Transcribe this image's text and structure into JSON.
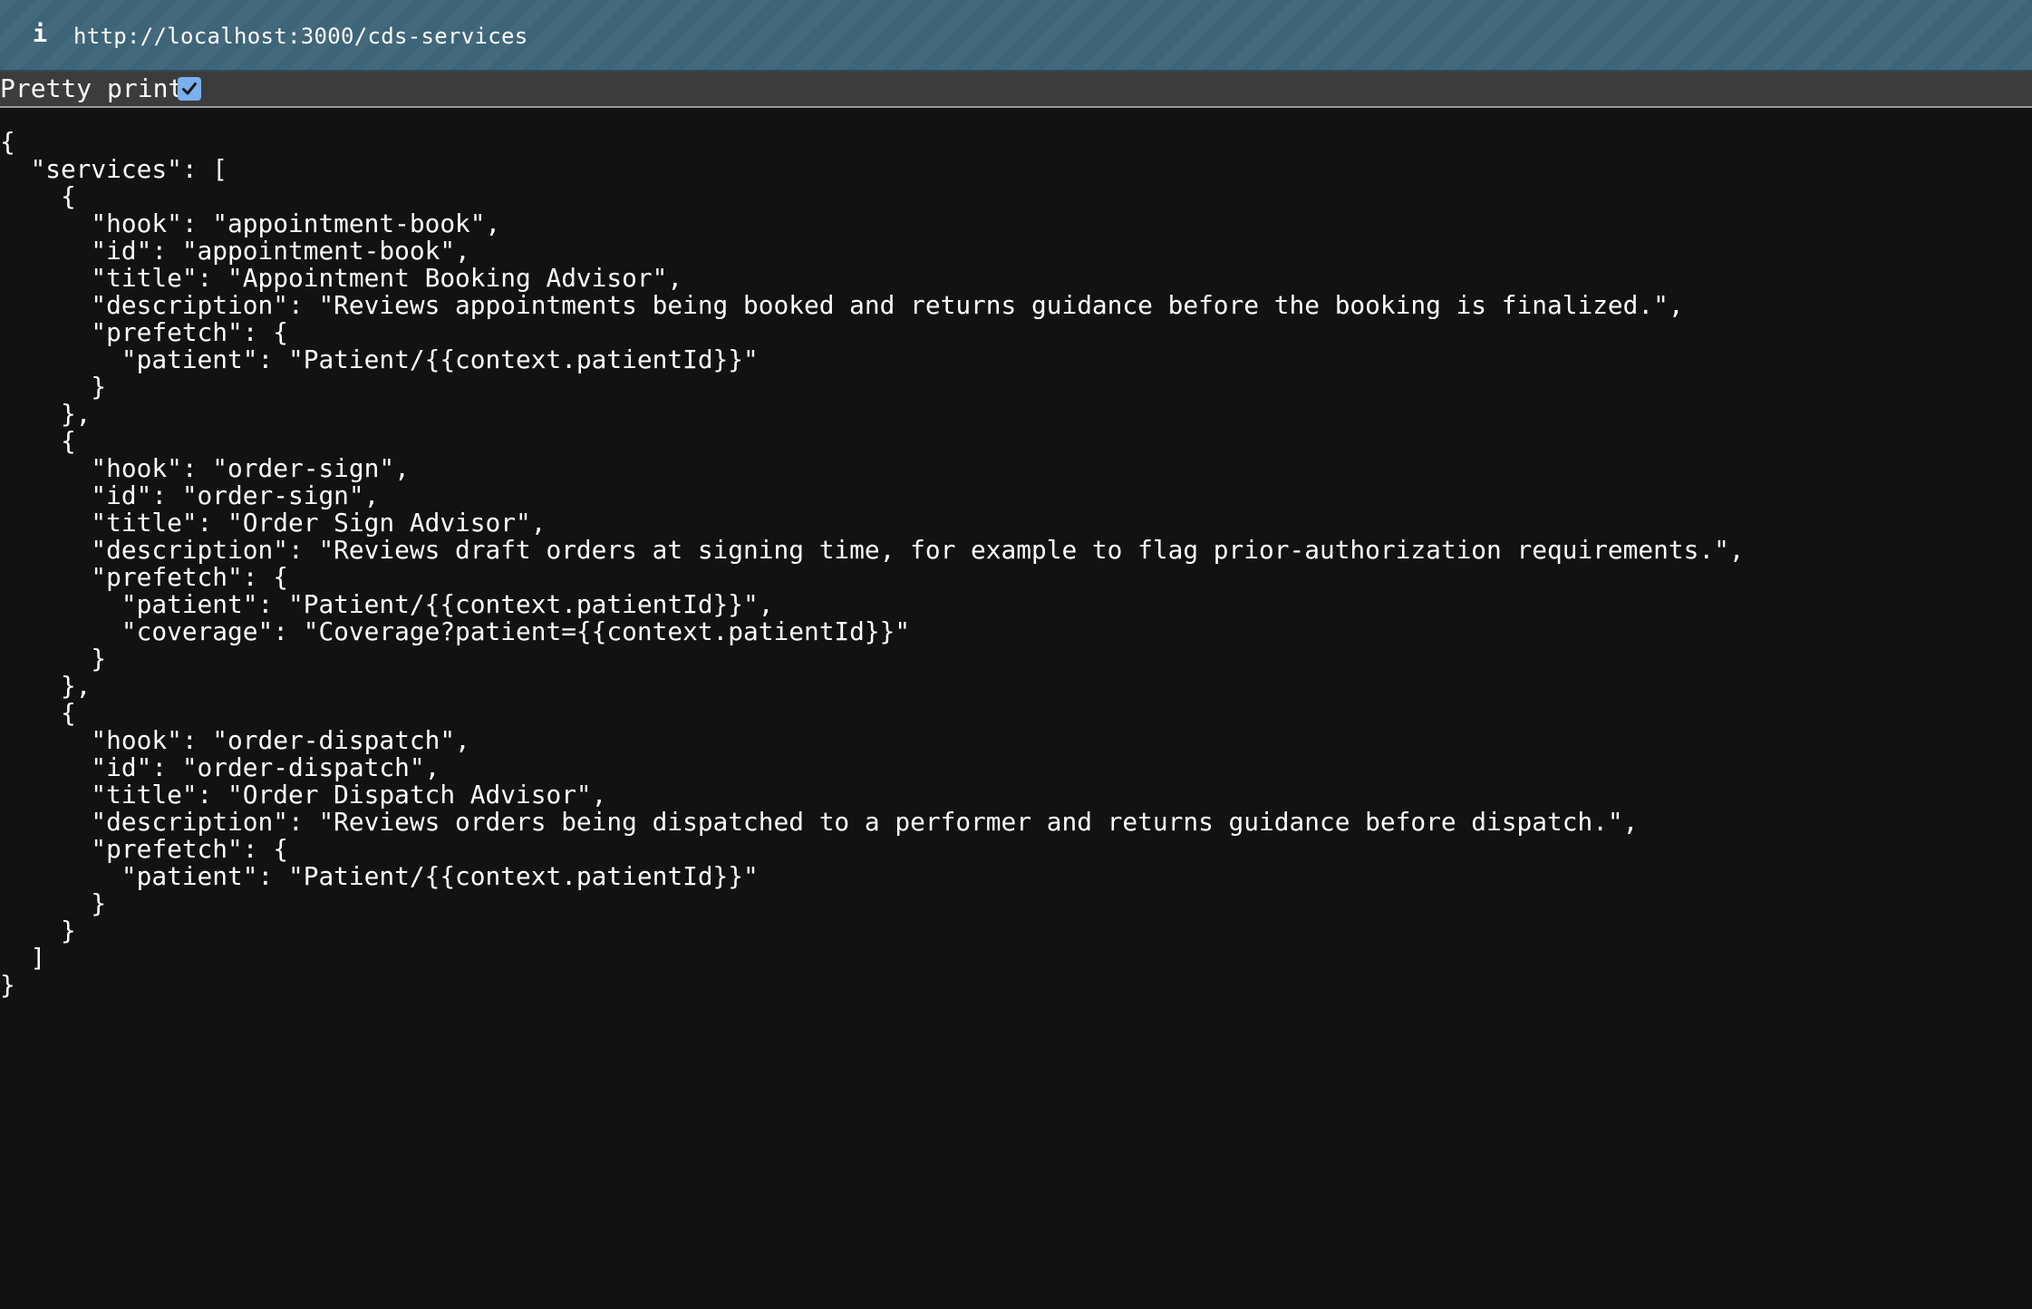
{
  "address_bar": {
    "icon": "info-icon",
    "icon_glyph": "i",
    "url": "http://localhost:3000/cds-services"
  },
  "toolbar": {
    "pretty_print_label": "Pretty print",
    "pretty_print_checked": true
  },
  "json_text": "{\n  \"services\": [\n    {\n      \"hook\": \"appointment-book\",\n      \"id\": \"appointment-book\",\n      \"title\": \"Appointment Booking Advisor\",\n      \"description\": \"Reviews appointments being booked and returns guidance before the booking is finalized.\",\n      \"prefetch\": {\n        \"patient\": \"Patient/{{context.patientId}}\"\n      }\n    },\n    {\n      \"hook\": \"order-sign\",\n      \"id\": \"order-sign\",\n      \"title\": \"Order Sign Advisor\",\n      \"description\": \"Reviews draft orders at signing time, for example to flag prior-authorization requirements.\",\n      \"prefetch\": {\n        \"patient\": \"Patient/{{context.patientId}}\",\n        \"coverage\": \"Coverage?patient={{context.patientId}}\"\n      }\n    },\n    {\n      \"hook\": \"order-dispatch\",\n      \"id\": \"order-dispatch\",\n      \"title\": \"Order Dispatch Advisor\",\n      \"description\": \"Reviews orders being dispatched to a performer and returns guidance before dispatch.\",\n      \"prefetch\": {\n        \"patient\": \"Patient/{{context.patientId}}\"\n      }\n    }\n  ]\n}",
  "colors": {
    "address_bar_bg": "#3d6478",
    "toolbar_bg": "#3c3c3c",
    "page_bg": "#121212",
    "text": "#ffffff",
    "checkbox_accent": "#7bb0ee"
  }
}
